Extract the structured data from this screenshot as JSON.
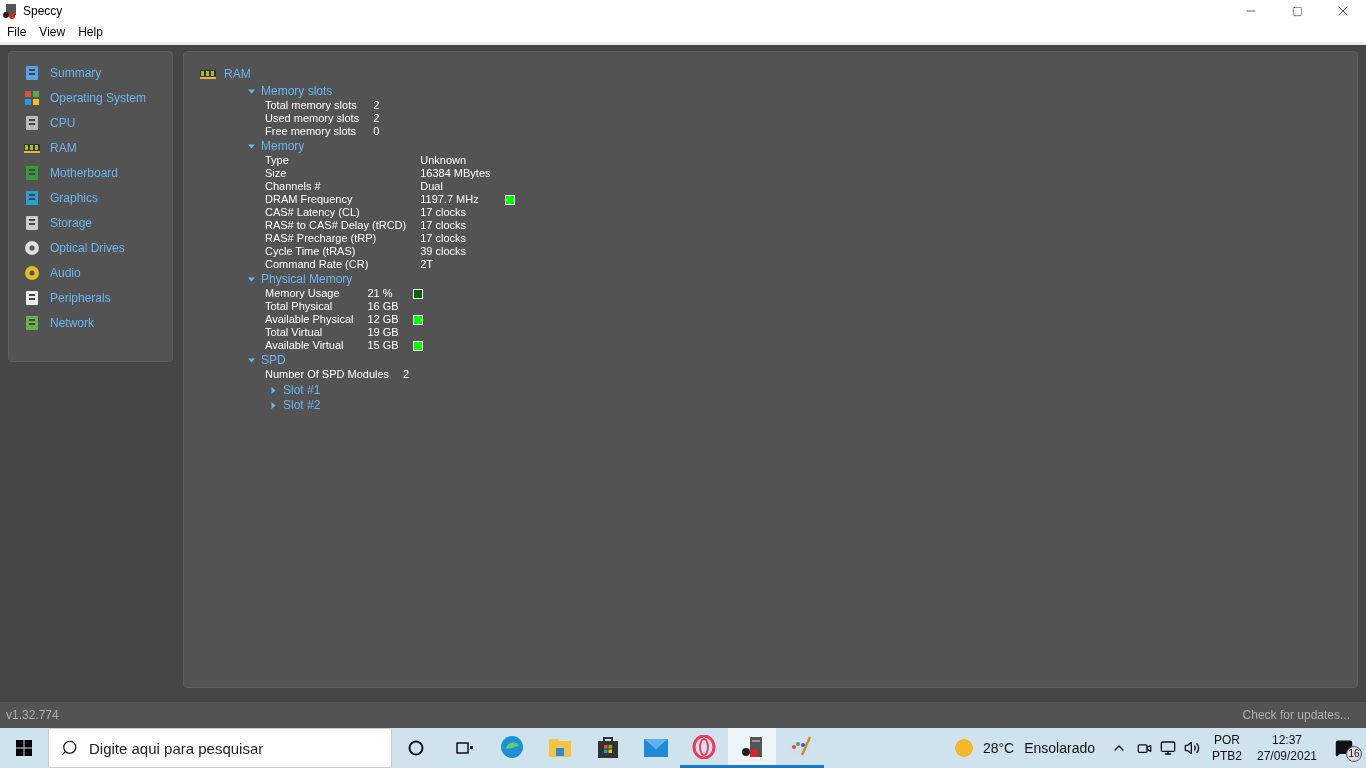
{
  "window": {
    "title": "Speccy"
  },
  "menu": [
    "File",
    "View",
    "Help"
  ],
  "sidebar": {
    "items": [
      {
        "label": "Summary"
      },
      {
        "label": "Operating System"
      },
      {
        "label": "CPU"
      },
      {
        "label": "RAM"
      },
      {
        "label": "Motherboard"
      },
      {
        "label": "Graphics"
      },
      {
        "label": "Storage"
      },
      {
        "label": "Optical Drives"
      },
      {
        "label": "Audio"
      },
      {
        "label": "Peripherals"
      },
      {
        "label": "Network"
      }
    ]
  },
  "content": {
    "title": "RAM",
    "sections": [
      {
        "title": "Memory slots",
        "expanded": true,
        "rows": [
          {
            "label": "Total memory slots",
            "value": "2"
          },
          {
            "label": "Used memory slots",
            "value": "2"
          },
          {
            "label": "Free memory slots",
            "value": "0"
          }
        ]
      },
      {
        "title": "Memory",
        "expanded": true,
        "rows": [
          {
            "label": "Type",
            "value": "Unknown"
          },
          {
            "label": "Size",
            "value": "16384 MBytes"
          },
          {
            "label": "Channels #",
            "value": "Dual"
          },
          {
            "label": "DRAM Frequency",
            "value": "1197.7 MHz",
            "color": "#00ff00"
          },
          {
            "label": "CAS# Latency (CL)",
            "value": "17 clocks"
          },
          {
            "label": "RAS# to CAS# Delay (tRCD)",
            "value": "17 clocks"
          },
          {
            "label": "RAS# Precharge (tRP)",
            "value": "17 clocks"
          },
          {
            "label": "Cycle Time (tRAS)",
            "value": "39 clocks"
          },
          {
            "label": "Command Rate (CR)",
            "value": "2T"
          }
        ]
      },
      {
        "title": "Physical Memory",
        "expanded": true,
        "rows": [
          {
            "label": "Memory Usage",
            "value": "21 %",
            "color": "#006400"
          },
          {
            "label": "Total Physical",
            "value": "16 GB"
          },
          {
            "label": "Available Physical",
            "value": "12 GB",
            "color": "#00ff00"
          },
          {
            "label": "Total Virtual",
            "value": "19 GB"
          },
          {
            "label": "Available Virtual",
            "value": "15 GB",
            "color": "#00ff00"
          }
        ]
      },
      {
        "title": "SPD",
        "expanded": true,
        "rows": [
          {
            "label": "Number Of SPD Modules",
            "value": "2"
          }
        ],
        "children": [
          {
            "title": "Slot #1",
            "expanded": false
          },
          {
            "title": "Slot #2",
            "expanded": false
          }
        ]
      }
    ]
  },
  "status_bar": {
    "version": "v1.32.774",
    "link": "Check for updates..."
  },
  "taskbar": {
    "search": {
      "placeholder": "Digite aqui para pesquisar"
    },
    "apps": [
      {
        "running": false,
        "focused": false
      },
      {
        "running": false,
        "focused": false
      },
      {
        "running": false,
        "focused": false
      },
      {
        "running": false,
        "focused": false
      },
      {
        "running": true,
        "focused": false
      },
      {
        "running": true,
        "focused": true
      },
      {
        "running": true,
        "focused": false
      }
    ],
    "weather": {
      "temp": "28°C",
      "text": "Ensolarado"
    },
    "lang": [
      "POR",
      "PTB2"
    ],
    "time": "12:37",
    "date": "27/09/2021",
    "notifications": "16"
  }
}
